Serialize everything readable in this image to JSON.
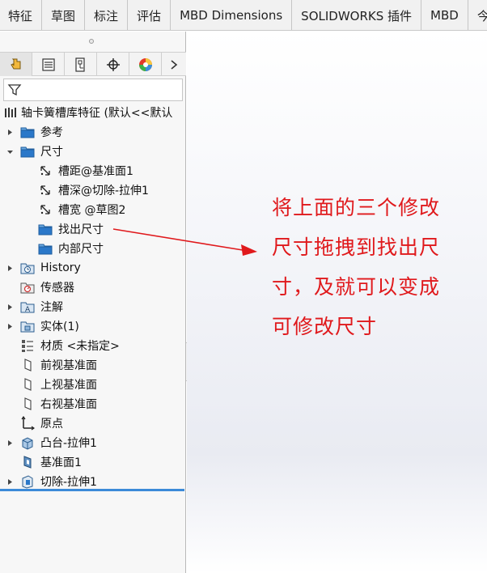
{
  "tabs": [
    "特征",
    "草图",
    "标注",
    "评估",
    "MBD Dimensions",
    "SOLIDWORKS 插件",
    "MBD",
    "今日"
  ],
  "panel_icons": [
    "feature-manager-icon",
    "property-manager-icon",
    "configuration-manager-icon",
    "dimxpert-icon",
    "display-manager-icon",
    "chevron-right-icon"
  ],
  "tree": {
    "root": "轴卡簧槽库特征  (默认<<默认",
    "items": [
      {
        "label": "参考",
        "icon": "folder-icon",
        "expand": "collapsed",
        "level": 1
      },
      {
        "label": "尺寸",
        "icon": "folder-icon",
        "expand": "expanded",
        "level": 1
      },
      {
        "label": "槽距@基准面1",
        "icon": "dimension-icon",
        "expand": "none",
        "level": 2
      },
      {
        "label": "槽深@切除-拉伸1",
        "icon": "dimension-icon",
        "expand": "none",
        "level": 2
      },
      {
        "label": "槽宽 @草图2",
        "icon": "dimension-icon",
        "expand": "none",
        "level": 2
      },
      {
        "label": "找出尺寸",
        "icon": "folder-icon",
        "expand": "none",
        "level": 2
      },
      {
        "label": "内部尺寸",
        "icon": "folder-icon",
        "expand": "none",
        "level": 2
      },
      {
        "label": "History",
        "icon": "history-icon",
        "expand": "collapsed",
        "level": 1
      },
      {
        "label": "传感器",
        "icon": "sensor-icon",
        "expand": "none",
        "level": 1
      },
      {
        "label": "注解",
        "icon": "annotation-icon",
        "expand": "collapsed",
        "level": 1
      },
      {
        "label": "实体(1)",
        "icon": "solid-body-icon",
        "expand": "collapsed",
        "level": 1
      },
      {
        "label": "材质 <未指定>",
        "icon": "material-icon",
        "expand": "none",
        "level": 1
      },
      {
        "label": "前视基准面",
        "icon": "plane-icon",
        "expand": "none",
        "level": 1
      },
      {
        "label": "上视基准面",
        "icon": "plane-icon",
        "expand": "none",
        "level": 1
      },
      {
        "label": "右视基准面",
        "icon": "plane-icon",
        "expand": "none",
        "level": 1
      },
      {
        "label": "原点",
        "icon": "origin-icon",
        "expand": "none",
        "level": 1
      },
      {
        "label": "凸台-拉伸1",
        "icon": "extrude-boss-icon",
        "expand": "collapsed",
        "level": 1
      },
      {
        "label": "基准面1",
        "icon": "plane1-icon",
        "expand": "none",
        "level": 1
      },
      {
        "label": "切除-拉伸1",
        "icon": "extrude-cut-icon",
        "expand": "collapsed",
        "level": 1
      }
    ]
  },
  "note": {
    "lines": [
      "将上面的三个修改",
      "尺寸拖拽到找出尺",
      "寸，及就可以变成",
      "可修改尺寸"
    ],
    "color": "#e0191c"
  },
  "colors": {
    "selection_line": "#3c8ad8",
    "folder": "#2b6cb3"
  }
}
